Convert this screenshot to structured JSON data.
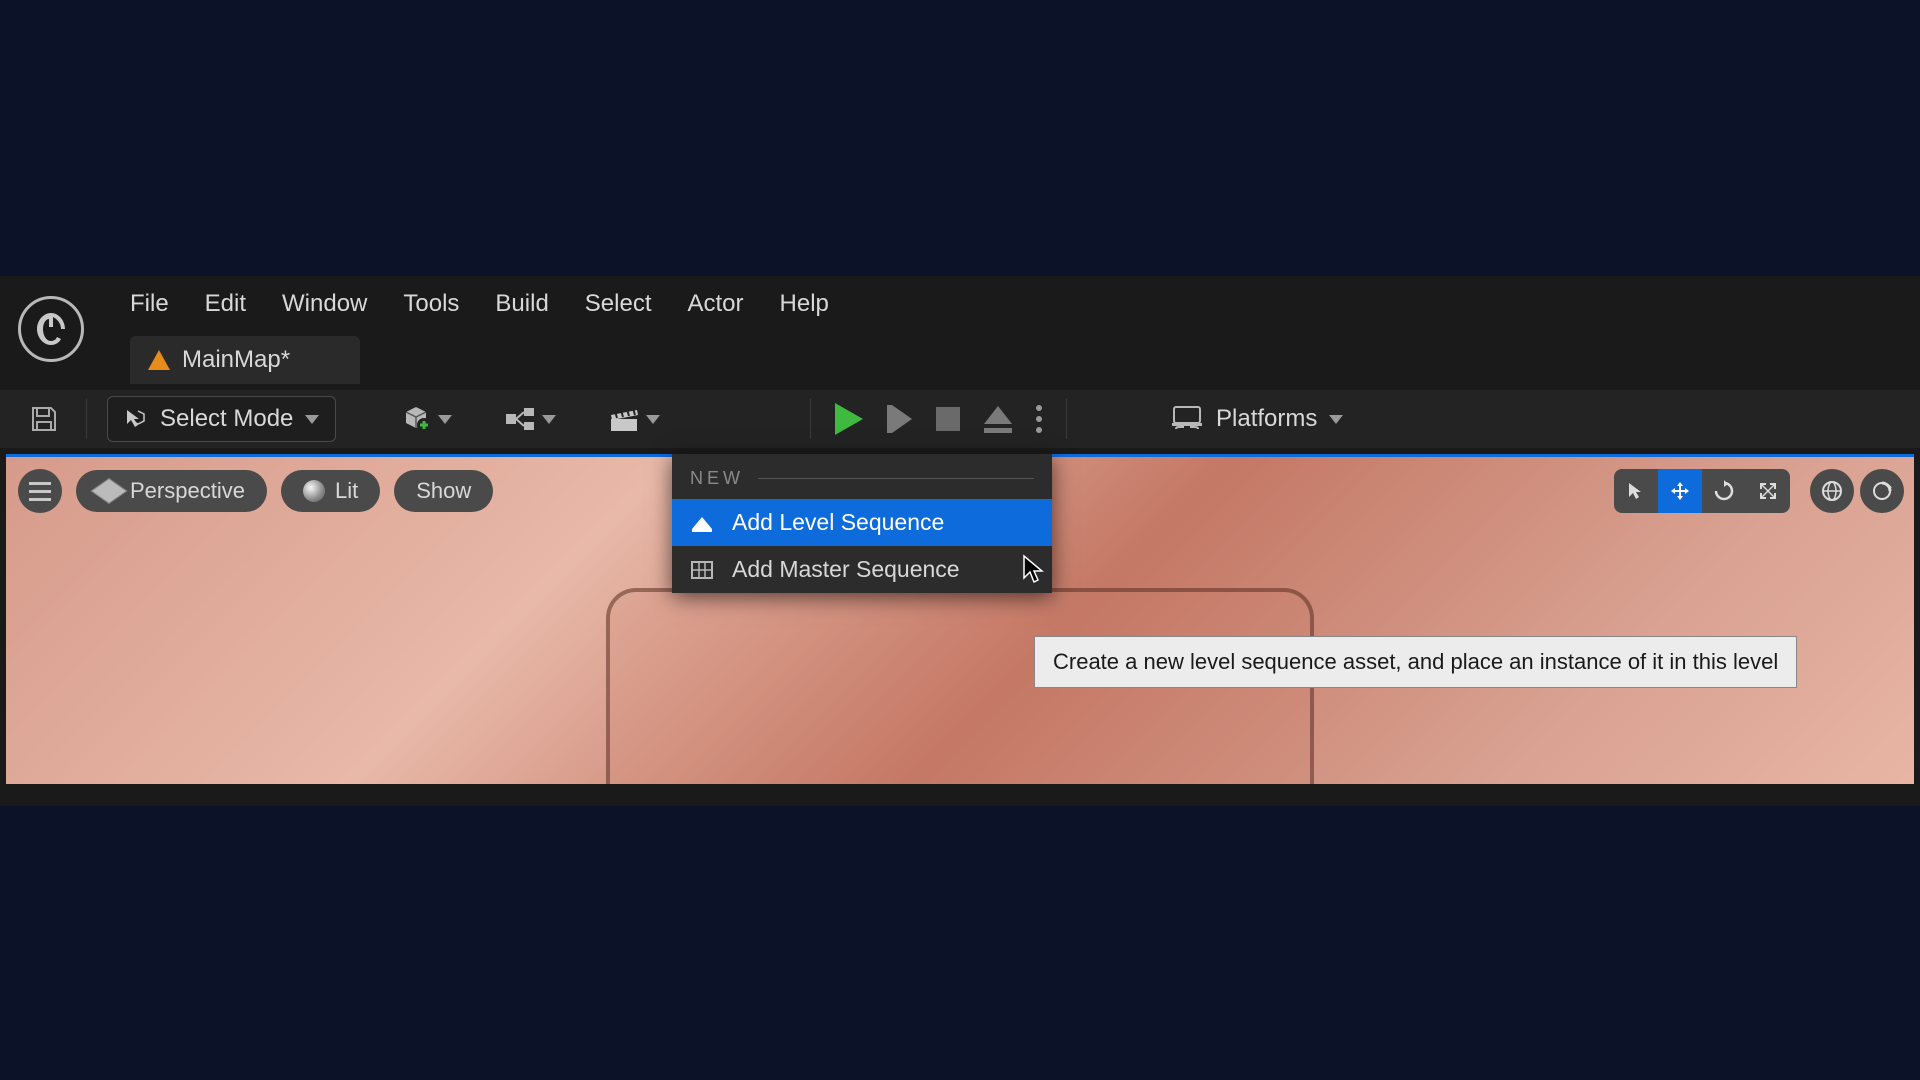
{
  "menubar": {
    "items": [
      "File",
      "Edit",
      "Window",
      "Tools",
      "Build",
      "Select",
      "Actor",
      "Help"
    ]
  },
  "tab": {
    "label": "MainMap*"
  },
  "toolbar": {
    "mode_label": "Select Mode",
    "platforms_label": "Platforms"
  },
  "viewport": {
    "perspective": "Perspective",
    "lit": "Lit",
    "show": "Show"
  },
  "dropdown": {
    "section": "NEW",
    "items": [
      {
        "label": "Add Level Sequence",
        "highlighted": true
      },
      {
        "label": "Add Master Sequence",
        "highlighted": false
      }
    ]
  },
  "tooltip": "Create a new level sequence asset, and place an instance of it in this level"
}
